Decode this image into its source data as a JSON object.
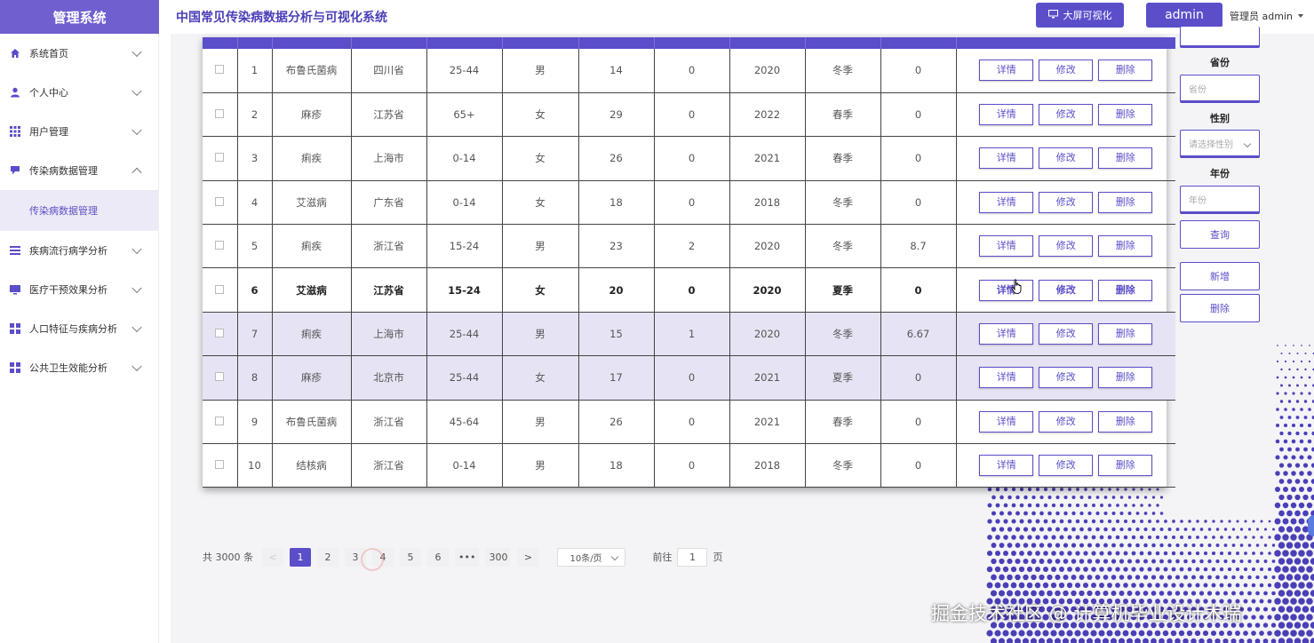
{
  "brand": "管理系统",
  "header": {
    "title": "中国常见传染病数据分析与可视化系统",
    "bigscreen_label": "大屏可视化",
    "admin_label": "admin",
    "user_label": "管理员 admin"
  },
  "sidebar": {
    "items": [
      {
        "label": "系统首页",
        "icon": "home-icon"
      },
      {
        "label": "个人中心",
        "icon": "user-icon"
      },
      {
        "label": "用户管理",
        "icon": "grid-icon"
      },
      {
        "label": "传染病数据管理",
        "icon": "chat-icon"
      },
      {
        "label": "疾病流行病学分析",
        "icon": "list-icon"
      },
      {
        "label": "医疗干预效果分析",
        "icon": "monitor-icon"
      },
      {
        "label": "人口特征与疾病分析",
        "icon": "grid-icon"
      },
      {
        "label": "公共卫生效能分析",
        "icon": "grid-icon"
      }
    ],
    "active_sub": "传染病数据管理"
  },
  "table": {
    "actions": {
      "detail": "详情",
      "edit": "修改",
      "delete": "删除"
    },
    "rows": [
      [
        "1",
        "布鲁氏菌病",
        "四川省",
        "25-44",
        "男",
        "14",
        "0",
        "2020",
        "冬季",
        "0"
      ],
      [
        "2",
        "麻疹",
        "江苏省",
        "65+",
        "女",
        "29",
        "0",
        "2022",
        "春季",
        "0"
      ],
      [
        "3",
        "痢疾",
        "上海市",
        "0-14",
        "女",
        "26",
        "0",
        "2021",
        "春季",
        "0"
      ],
      [
        "4",
        "艾滋病",
        "广东省",
        "0-14",
        "女",
        "18",
        "0",
        "2018",
        "冬季",
        "0"
      ],
      [
        "5",
        "痢疾",
        "浙江省",
        "15-24",
        "男",
        "23",
        "2",
        "2020",
        "冬季",
        "8.7"
      ],
      [
        "6",
        "艾滋病",
        "江苏省",
        "15-24",
        "女",
        "20",
        "0",
        "2020",
        "夏季",
        "0"
      ],
      [
        "7",
        "痢疾",
        "上海市",
        "25-44",
        "男",
        "15",
        "1",
        "2020",
        "冬季",
        "6.67"
      ],
      [
        "8",
        "麻疹",
        "北京市",
        "25-44",
        "女",
        "17",
        "0",
        "2021",
        "夏季",
        "0"
      ],
      [
        "9",
        "布鲁氏菌病",
        "浙江省",
        "45-64",
        "男",
        "26",
        "0",
        "2021",
        "春季",
        "0"
      ],
      [
        "10",
        "结核病",
        "浙江省",
        "0-14",
        "男",
        "18",
        "0",
        "2018",
        "冬季",
        "0"
      ]
    ]
  },
  "filters": {
    "province_label": "省份",
    "province_placeholder": "省份",
    "gender_label": "性别",
    "gender_placeholder": "请选择性别",
    "year_label": "年份",
    "year_placeholder": "年份",
    "query_label": "查询",
    "add_label": "新增",
    "delete_label": "删除"
  },
  "pagination": {
    "total": "共 3000 条",
    "prev": "<",
    "next": ">",
    "pages": [
      "1",
      "2",
      "3",
      "4",
      "5",
      "6",
      "•••",
      "300"
    ],
    "current": "1",
    "page_size": "10条/页",
    "goto_prefix": "前往",
    "goto_value": "1",
    "goto_suffix": "页"
  },
  "watermark": "掘金技术社区 @ 计算机毕业设计木瑞",
  "colors": {
    "accent": "#5a4ec9",
    "brand": "#6f5fcf",
    "row_highlight": "#e6e4f4"
  }
}
